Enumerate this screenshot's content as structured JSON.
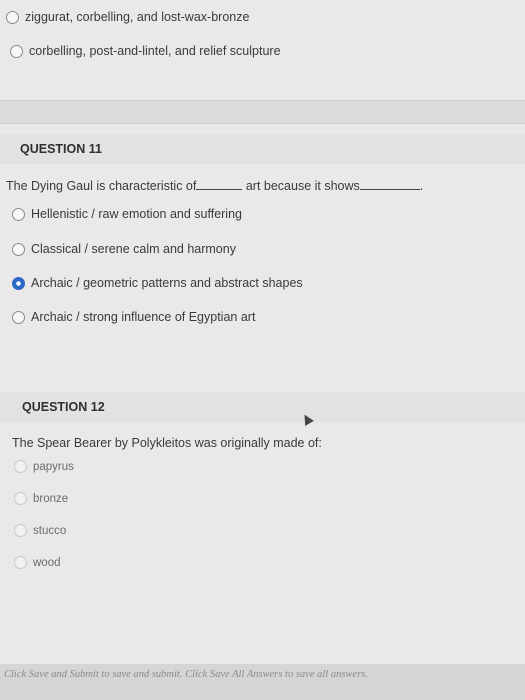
{
  "prev_question": {
    "options": [
      {
        "label": "ziggurat, corbelling, and lost-wax-bronze",
        "selected": false
      },
      {
        "label": "corbelling, post-and-lintel, and relief sculpture",
        "selected": false
      }
    ]
  },
  "q11": {
    "title": "QUESTION 11",
    "text_part1": "The Dying Gaul is characteristic of",
    "text_part2": "art because it shows",
    "text_end": ".",
    "options": [
      {
        "label": "Hellenistic  /  raw emotion and suffering",
        "selected": false
      },
      {
        "label": "Classical / serene calm and harmony",
        "selected": false
      },
      {
        "label": "Archaic / geometric patterns and abstract shapes",
        "selected": true
      },
      {
        "label": "Archaic /  strong influence of Egyptian art",
        "selected": false
      }
    ]
  },
  "q12": {
    "title": "QUESTION 12",
    "text": "The Spear Bearer by Polykleitos was originally made of:",
    "options": [
      {
        "label": "papyrus",
        "selected": false
      },
      {
        "label": "bronze",
        "selected": false
      },
      {
        "label": "stucco",
        "selected": false
      },
      {
        "label": "wood",
        "selected": false
      }
    ]
  },
  "footer": {
    "text": "Click Save and Submit to save and submit. Click Save All Answers to save all answers."
  },
  "colors": {
    "selected_radio": "#2d68c4",
    "background": "#ebe8ea"
  }
}
